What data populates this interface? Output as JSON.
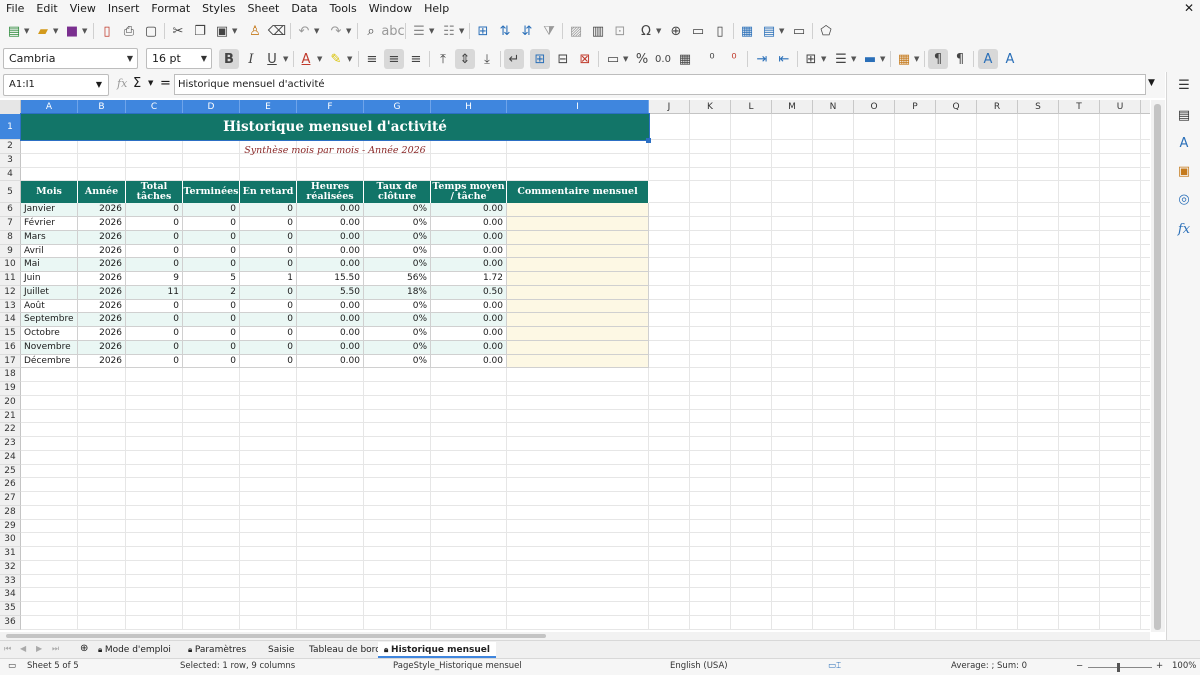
{
  "menu": [
    "File",
    "Edit",
    "View",
    "Insert",
    "Format",
    "Styles",
    "Sheet",
    "Data",
    "Tools",
    "Window",
    "Help"
  ],
  "toolbar": {
    "font_name": "Cambria",
    "font_size": "16 pt",
    "percent_symbol": "%",
    "decimal_symbol": "0.0"
  },
  "formula_bar": {
    "name_box": "A1:I1",
    "content": "Historique mensuel d'activité"
  },
  "columns": [
    "A",
    "B",
    "C",
    "D",
    "E",
    "F",
    "G",
    "H",
    "I",
    "J",
    "K",
    "L",
    "M",
    "N",
    "O",
    "P",
    "Q",
    "R",
    "S",
    "T",
    "U"
  ],
  "rows": [
    "1",
    "2",
    "3",
    "4",
    "5",
    "6",
    "7",
    "8",
    "9",
    "10",
    "11",
    "12",
    "13",
    "14",
    "15",
    "16",
    "17",
    "18",
    "19",
    "20",
    "21",
    "22",
    "23",
    "24",
    "25",
    "26",
    "27",
    "28",
    "29",
    "30",
    "31",
    "32",
    "33",
    "34",
    "35",
    "36"
  ],
  "sheet": {
    "title": "Historique mensuel d'activité",
    "subtitle": "Synthèse mois par mois - Année 2026",
    "headers": [
      "Mois",
      "Année",
      "Total tâches",
      "Terminées",
      "En retard",
      "Heures réalisées",
      "Taux de clôture",
      "Temps moyen / tâche",
      "Commentaire mensuel"
    ],
    "data": [
      [
        "Janvier",
        "2026",
        "0",
        "0",
        "0",
        "0.00",
        "0%",
        "0.00",
        ""
      ],
      [
        "Février",
        "2026",
        "0",
        "0",
        "0",
        "0.00",
        "0%",
        "0.00",
        ""
      ],
      [
        "Mars",
        "2026",
        "0",
        "0",
        "0",
        "0.00",
        "0%",
        "0.00",
        ""
      ],
      [
        "Avril",
        "2026",
        "0",
        "0",
        "0",
        "0.00",
        "0%",
        "0.00",
        ""
      ],
      [
        "Mai",
        "2026",
        "0",
        "0",
        "0",
        "0.00",
        "0%",
        "0.00",
        ""
      ],
      [
        "Juin",
        "2026",
        "9",
        "5",
        "1",
        "15.50",
        "56%",
        "1.72",
        ""
      ],
      [
        "Juillet",
        "2026",
        "11",
        "2",
        "0",
        "5.50",
        "18%",
        "0.50",
        ""
      ],
      [
        "Août",
        "2026",
        "0",
        "0",
        "0",
        "0.00",
        "0%",
        "0.00",
        ""
      ],
      [
        "Septembre",
        "2026",
        "0",
        "0",
        "0",
        "0.00",
        "0%",
        "0.00",
        ""
      ],
      [
        "Octobre",
        "2026",
        "0",
        "0",
        "0",
        "0.00",
        "0%",
        "0.00",
        ""
      ],
      [
        "Novembre",
        "2026",
        "0",
        "0",
        "0",
        "0.00",
        "0%",
        "0.00",
        ""
      ],
      [
        "Décembre",
        "2026",
        "0",
        "0",
        "0",
        "0.00",
        "0%",
        "0.00",
        ""
      ]
    ]
  },
  "tabs": [
    "Mode d'emploi",
    "Paramètres",
    "Saisie",
    "Tableau de bord",
    "Historique mensuel"
  ],
  "active_tab": "Historique mensuel",
  "status": {
    "sheet": "Sheet 5 of 5",
    "selection": "Selected: 1 row, 9 columns",
    "page_style": "PageStyle_Historique mensuel",
    "language": "English (USA)",
    "sum": "Average: ; Sum: 0",
    "zoom": "100%"
  },
  "colors": {
    "header_bg": "#127568",
    "row_alt": "#eaf7f4",
    "comment_bg": "#fdf8e4",
    "selection": "#3f86de",
    "subtitle": "#8a2828"
  }
}
